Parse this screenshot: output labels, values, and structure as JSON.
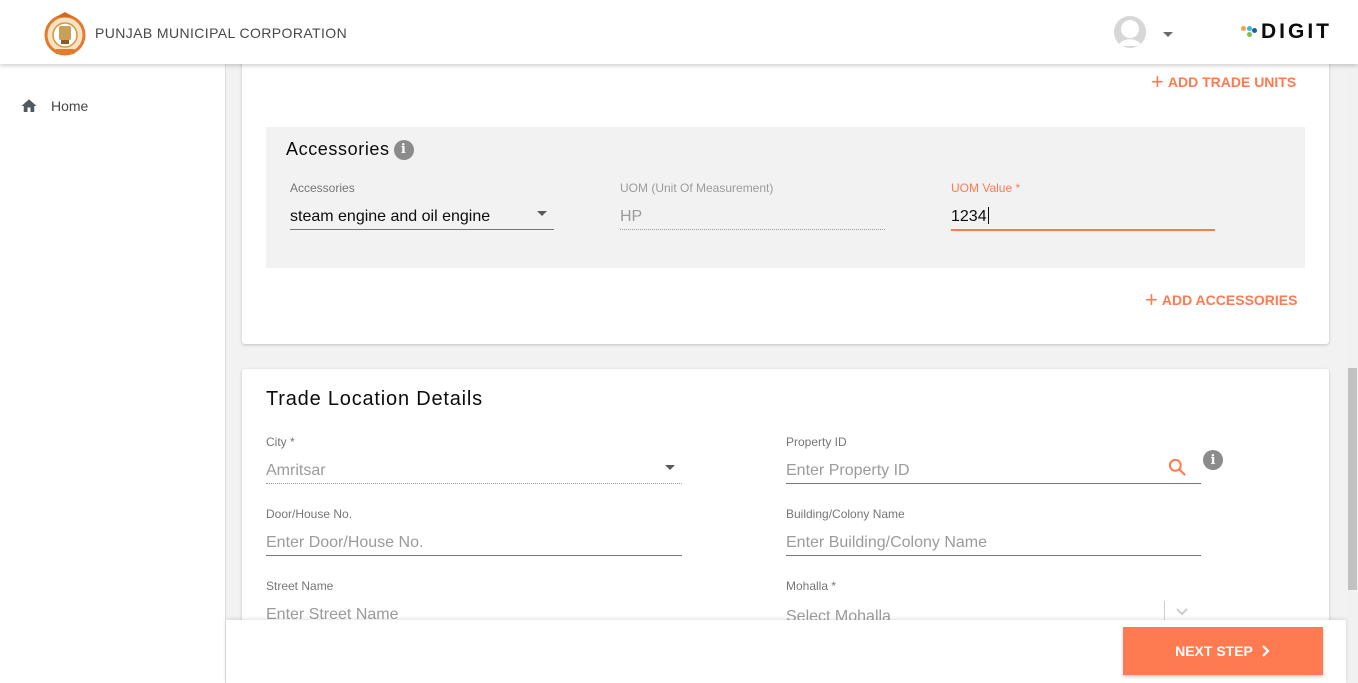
{
  "header": {
    "org_name": "PUNJAB MUNICIPAL CORPORATION",
    "brand": "DIGIT",
    "colors": {
      "accent": "#fe7a51",
      "text": "#484848"
    }
  },
  "sidebar": {
    "items": [
      {
        "label": "Home",
        "icon": "home-icon"
      }
    ]
  },
  "trade_units": {
    "add_label": "ADD TRADE UNITS"
  },
  "accessories": {
    "title": "Accessories",
    "accessory_label": "Accessories",
    "accessory_value": "steam engine and oil engine",
    "uom_label": "UOM (Unit Of Measurement)",
    "uom_value": "HP",
    "uom_value_label": "UOM Value *",
    "uom_value_value": "1234",
    "add_label": "ADD ACCESSORIES"
  },
  "location": {
    "title": "Trade Location Details",
    "city_label": "City *",
    "city_value": "Amritsar",
    "property_label": "Property ID",
    "property_placeholder": "Enter Property ID",
    "door_label": "Door/House No.",
    "door_placeholder": "Enter Door/House No.",
    "building_label": "Building/Colony Name",
    "building_placeholder": "Enter Building/Colony Name",
    "street_label": "Street Name",
    "street_placeholder": "Enter Street Name",
    "mohalla_label": "Mohalla *",
    "mohalla_placeholder": "Select Mohalla"
  },
  "footer": {
    "next_label": "NEXT STEP"
  }
}
